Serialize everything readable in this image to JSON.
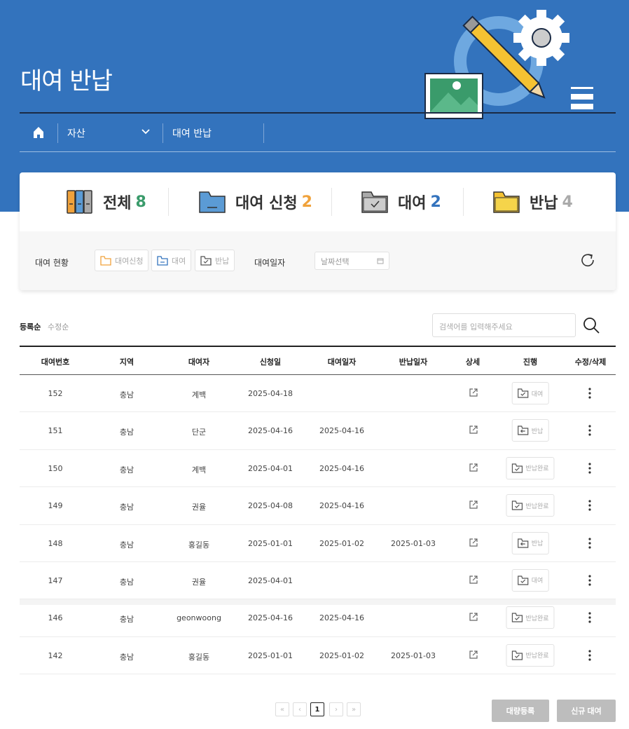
{
  "header": {
    "title": "대여 반납"
  },
  "breadcrumb": {
    "section": "자산",
    "page": "대여 반납"
  },
  "stats": [
    {
      "label": "전체",
      "count": "8",
      "color": "#3a9b6b"
    },
    {
      "label": "대여 신청",
      "count": "2",
      "color": "#f0a23b"
    },
    {
      "label": "대여",
      "count": "2",
      "color": "#3373bd"
    },
    {
      "label": "반납",
      "count": "4",
      "color": "#aaaaaa"
    }
  ],
  "filter": {
    "status_label": "대여 현황",
    "chips": [
      "대여신청",
      "대여",
      "반납"
    ],
    "date_label": "대여일자",
    "date_placeholder": "날짜선택"
  },
  "sort": {
    "registered": "등록순",
    "modified": "수정순"
  },
  "search": {
    "placeholder": "검색어를 입력해주세요"
  },
  "table": {
    "columns": [
      "대여번호",
      "지역",
      "대여자",
      "신청일",
      "대여일자",
      "반납일자",
      "상세",
      "진행",
      "수정/삭제"
    ],
    "rows": [
      {
        "no": "152",
        "region": "충남",
        "renter": "계백",
        "applied": "2025-04-18",
        "rented": "",
        "returned": "",
        "status": "대여"
      },
      {
        "no": "151",
        "region": "충남",
        "renter": "단군",
        "applied": "2025-04-16",
        "rented": "2025-04-16",
        "returned": "",
        "status": "반납"
      },
      {
        "no": "150",
        "region": "충남",
        "renter": "계백",
        "applied": "2025-04-01",
        "rented": "2025-04-16",
        "returned": "",
        "status": "반납완료"
      },
      {
        "no": "149",
        "region": "충남",
        "renter": "권율",
        "applied": "2025-04-08",
        "rented": "2025-04-16",
        "returned": "",
        "status": "반납완료"
      },
      {
        "no": "148",
        "region": "충남",
        "renter": "홍길동",
        "applied": "2025-01-01",
        "rented": "2025-01-02",
        "returned": "2025-01-03",
        "status": "반납"
      },
      {
        "no": "147",
        "region": "충남",
        "renter": "권율",
        "applied": "2025-04-01",
        "rented": "",
        "returned": "",
        "status": "대여"
      },
      {
        "no": "146",
        "region": "충남",
        "renter": "geonwoong",
        "applied": "2025-04-16",
        "rented": "2025-04-16",
        "returned": "",
        "status": "반납완료"
      },
      {
        "no": "142",
        "region": "충남",
        "renter": "홍길동",
        "applied": "2025-01-01",
        "rented": "2025-01-02",
        "returned": "2025-01-03",
        "status": "반납완료"
      }
    ]
  },
  "pagination": {
    "current": "1"
  },
  "actions": {
    "bulk": "대량등록",
    "new": "신규 대여"
  }
}
